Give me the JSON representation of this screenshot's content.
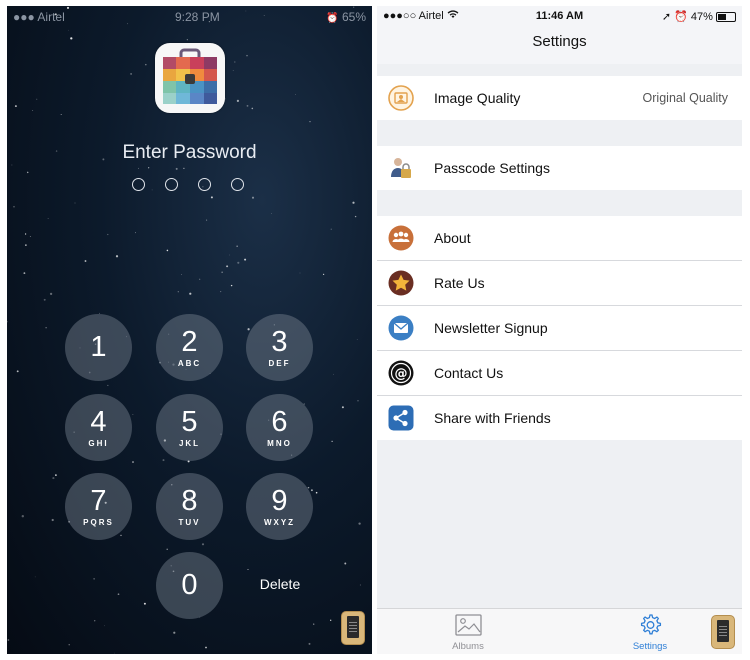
{
  "lock_screen": {
    "status": {
      "carrier": "●●● Airtel",
      "time": "9:28 PM",
      "battery": "65%"
    },
    "prompt": "Enter Password",
    "keys": [
      {
        "num": "1",
        "letters": ""
      },
      {
        "num": "2",
        "letters": "ABC"
      },
      {
        "num": "3",
        "letters": "DEF"
      },
      {
        "num": "4",
        "letters": "GHI"
      },
      {
        "num": "5",
        "letters": "JKL"
      },
      {
        "num": "6",
        "letters": "MNO"
      },
      {
        "num": "7",
        "letters": "PQRS"
      },
      {
        "num": "8",
        "letters": "TUV"
      },
      {
        "num": "9",
        "letters": "WXYZ"
      },
      {
        "num": "0",
        "letters": ""
      }
    ],
    "delete_label": "Delete"
  },
  "settings_screen": {
    "status": {
      "carrier": "●●●○○ Airtel",
      "time": "11:46 AM",
      "battery": "47%"
    },
    "title": "Settings",
    "image_quality": {
      "label": "Image Quality",
      "value": "Original Quality"
    },
    "passcode": {
      "label": "Passcode Settings"
    },
    "menu": [
      {
        "label": "About",
        "icon": "about-icon"
      },
      {
        "label": "Rate Us",
        "icon": "star-icon"
      },
      {
        "label": "Newsletter Signup",
        "icon": "mail-icon"
      },
      {
        "label": "Contact Us",
        "icon": "at-icon"
      },
      {
        "label": "Share with Friends",
        "icon": "share-icon"
      }
    ],
    "tabs": [
      {
        "label": "Albums",
        "active": false
      },
      {
        "label": "Settings",
        "active": true
      }
    ]
  },
  "colors": {
    "accent": "#2f7fd6",
    "icon_orange": "#d98a3a",
    "tab_inactive": "#8f8f94"
  }
}
